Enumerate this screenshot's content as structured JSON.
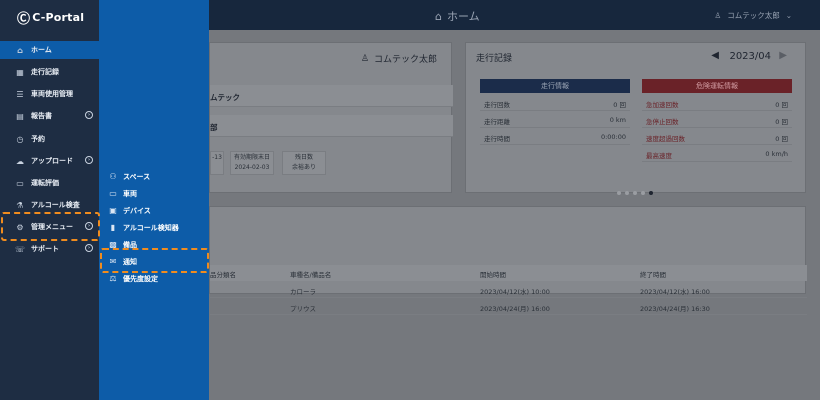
{
  "app": {
    "logo": "C-Portal"
  },
  "header": {
    "title": "ホーム",
    "user": "コムテック太郎"
  },
  "sidebar": {
    "items": [
      {
        "label": "ホーム",
        "icon": "home-icon",
        "glyph": "⌂",
        "active": true
      },
      {
        "label": "走行記録",
        "icon": "calendar-icon",
        "glyph": "▦"
      },
      {
        "label": "車両使用管理",
        "icon": "list-icon",
        "glyph": "☰"
      },
      {
        "label": "報告書",
        "icon": "report-icon",
        "glyph": "▤",
        "expand": true
      },
      {
        "label": "予約",
        "icon": "clock-icon",
        "glyph": "◷"
      },
      {
        "label": "アップロード",
        "icon": "upload-icon",
        "glyph": "☁",
        "expand": true
      },
      {
        "label": "運転評価",
        "icon": "car-icon",
        "glyph": "▭"
      },
      {
        "label": "アルコール検査",
        "icon": "alcohol-icon",
        "glyph": "⚗"
      },
      {
        "label": "管理メニュー",
        "icon": "admin-icon",
        "glyph": "⚙",
        "expand": true
      },
      {
        "label": "サポート",
        "icon": "support-icon",
        "glyph": "☏",
        "expand": true
      }
    ]
  },
  "submenu": {
    "items": [
      {
        "label": "スペース",
        "icon": "people-icon",
        "glyph": "⚇"
      },
      {
        "label": "車両",
        "icon": "car-icon",
        "glyph": "▭"
      },
      {
        "label": "デバイス",
        "icon": "device-icon",
        "glyph": "▣"
      },
      {
        "label": "アルコール検知器",
        "icon": "detector-icon",
        "glyph": "▮"
      },
      {
        "label": "備品",
        "icon": "box-icon",
        "glyph": "▩"
      },
      {
        "label": "通知",
        "icon": "mail-icon",
        "glyph": "✉"
      },
      {
        "label": "優先度設定",
        "icon": "priority-icon",
        "glyph": "⚖"
      }
    ]
  },
  "profile": {
    "name": "コムテック太郎",
    "rows": [
      "ムテック",
      "部"
    ],
    "mini": [
      {
        "label": "",
        "value": "-13"
      },
      {
        "label": "有効期限末日",
        "value": "2024-02-03"
      },
      {
        "label": "残日数",
        "value": "余裕あり"
      }
    ]
  },
  "driving": {
    "title": "走行記録",
    "month": "2023/04",
    "run_header": "走行情報",
    "danger_header": "危険運転情報",
    "run": [
      {
        "k": "走行回数",
        "v": "0 回"
      },
      {
        "k": "走行距離",
        "v": "0 km"
      },
      {
        "k": "走行時間",
        "v": "0:00:00"
      }
    ],
    "danger": [
      {
        "k": "急加速回数",
        "v": "0 回"
      },
      {
        "k": "急停止回数",
        "v": "0 回"
      },
      {
        "k": "速度超過回数",
        "v": "0 回"
      },
      {
        "k": "最高速度",
        "v": "0 km/h"
      }
    ],
    "page_dots": 5,
    "active_dot": 4
  },
  "reservations": {
    "headers": [
      "品分類名",
      "車種名/備品名",
      "開始時間",
      "終了時間"
    ],
    "rows": [
      [
        "",
        "カローラ",
        "2023/04/12(水) 10:00",
        "2023/04/12(水) 16:00"
      ],
      [
        "",
        "プリウス",
        "2023/04/24(月) 16:00",
        "2023/04/24(月) 16:30"
      ]
    ]
  }
}
